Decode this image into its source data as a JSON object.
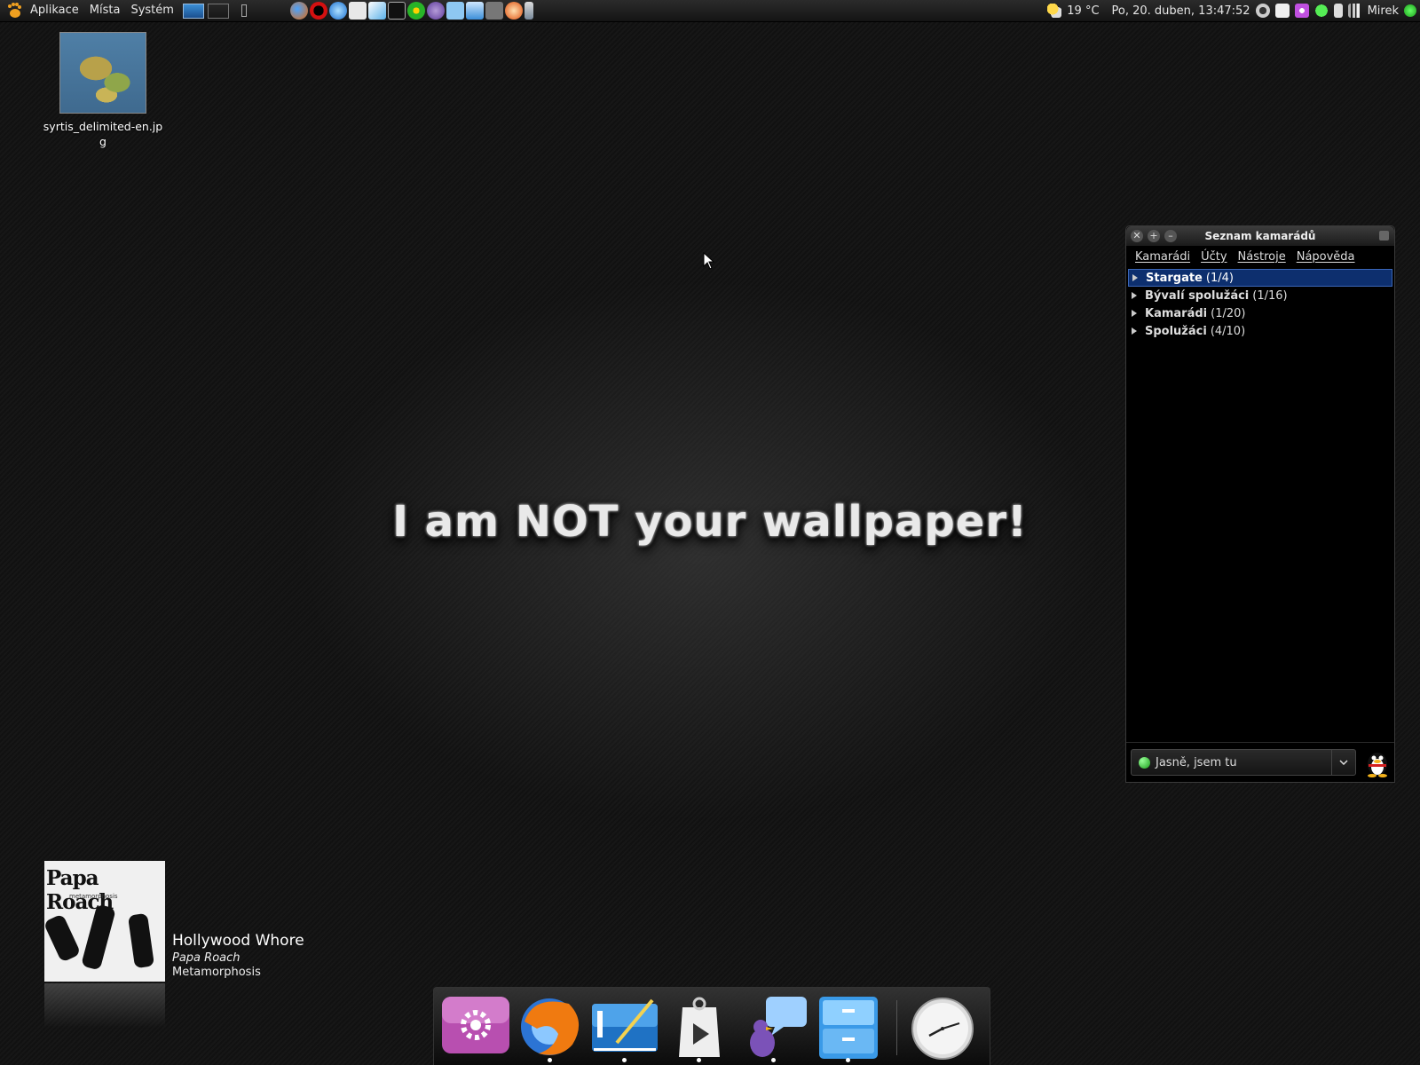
{
  "top_panel": {
    "menus": [
      "Aplikace",
      "Místa",
      "Systém"
    ],
    "weather": "19 °C",
    "clock": "Po, 20. duben, 13:47:52",
    "user": "Mirek"
  },
  "desktop": {
    "file_name": "syrtis_delimited-en.jpg",
    "wallpaper_text": "I am NOT your wallpaper!"
  },
  "buddy_list": {
    "title": "Seznam kamarádů",
    "menu": [
      "Kamarádi",
      "Účty",
      "Nástroje",
      "Nápověda"
    ],
    "groups": [
      {
        "name": "Stargate",
        "count": "(1/4)",
        "selected": true
      },
      {
        "name": "Bývalí spolužáci",
        "count": "(1/16)"
      },
      {
        "name": "Kamarádi",
        "count": "(1/20)"
      },
      {
        "name": "Spolužáci",
        "count": "(4/10)"
      }
    ],
    "status": "Jasně, jsem tu",
    "colors": {
      "selected": "#0d2f6e",
      "status_online": "#1a9e1a"
    }
  },
  "now_playing": {
    "album_art_text": "Papa Roach",
    "album_art_sub": "metamorphosis",
    "title": "Hollywood Whore",
    "artist": "Papa Roach",
    "album": "Metamorphosis"
  },
  "dock": {
    "items": [
      "settings-icon",
      "firefox-icon",
      "text-editor-icon",
      "media-player-icon",
      "pidgin-icon",
      "file-manager-icon",
      "clock-icon"
    ]
  }
}
